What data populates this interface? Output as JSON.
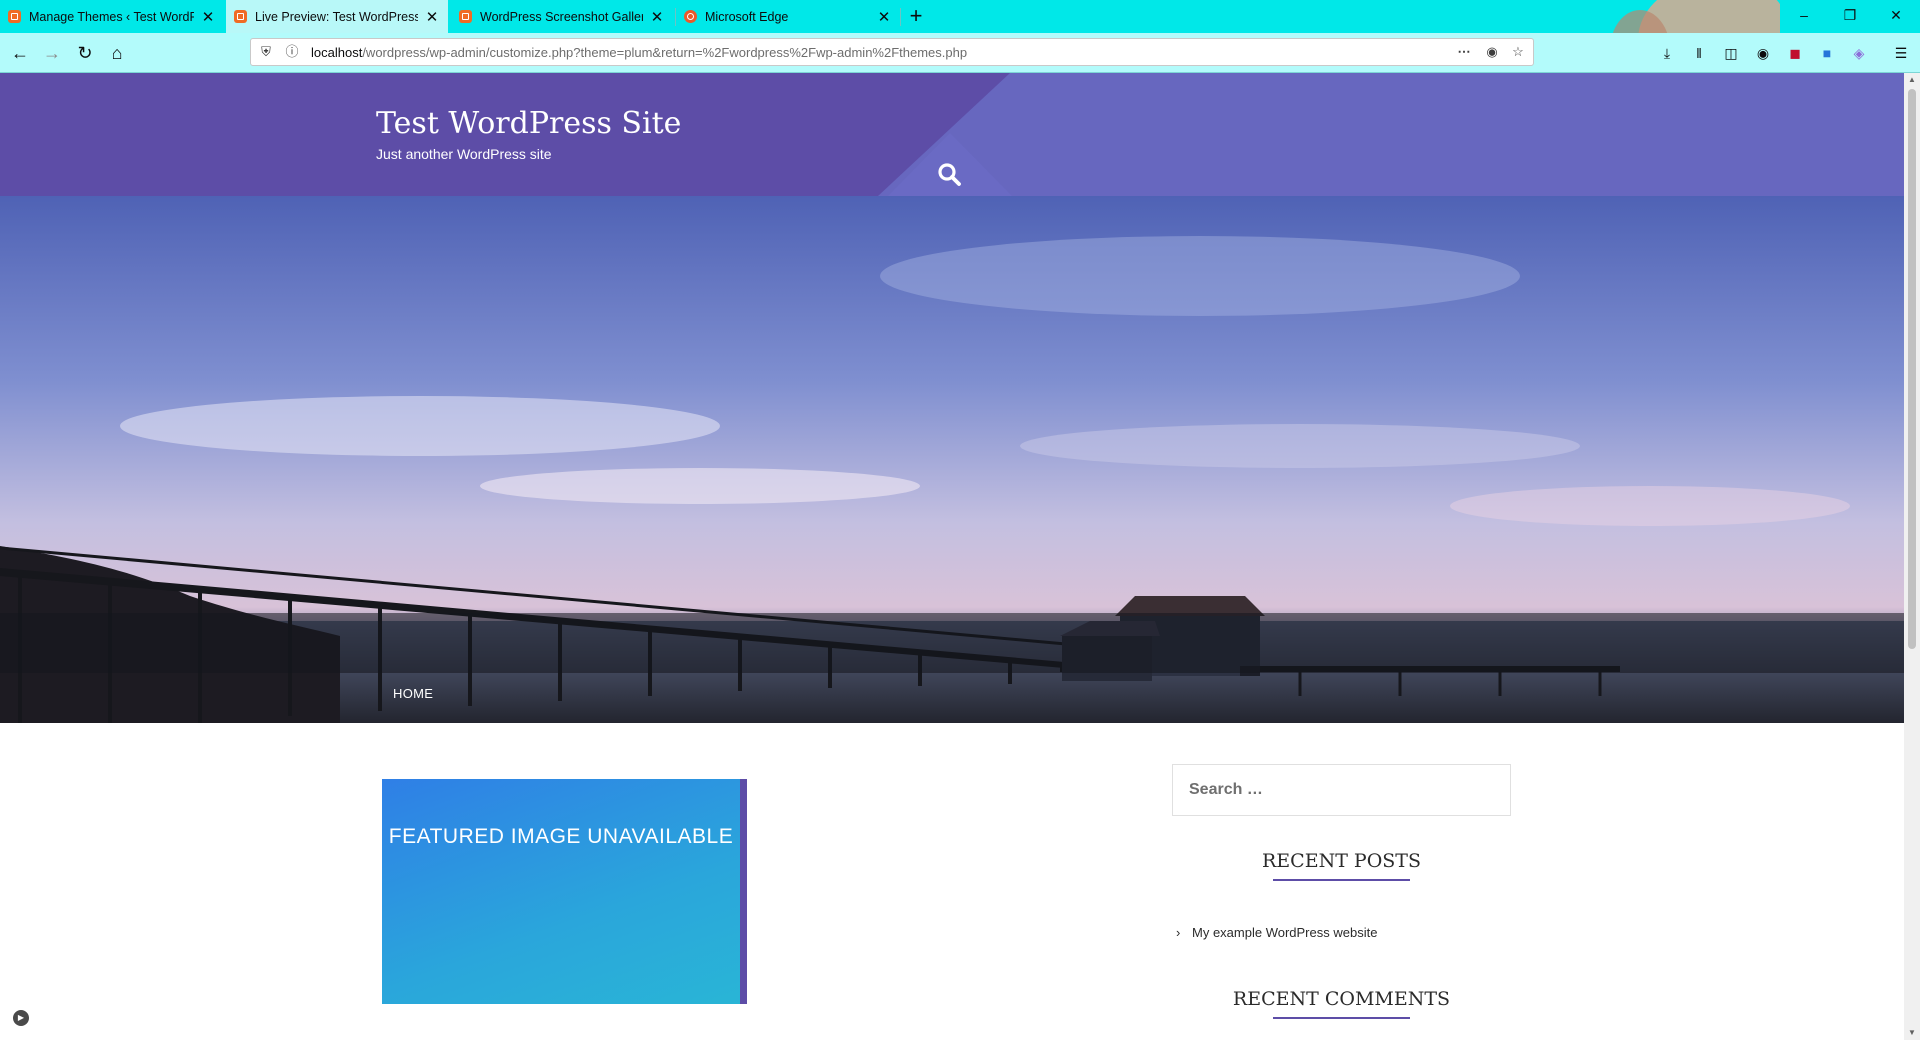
{
  "browser": {
    "tabs": [
      {
        "title": "Manage Themes ‹ Test WordPr",
        "active": false,
        "icon": "wordpress-favicon-icon"
      },
      {
        "title": "Live Preview: Test WordPress Si",
        "active": true,
        "icon": "wordpress-favicon-icon"
      },
      {
        "title": "WordPress Screenshot Gallery",
        "active": false,
        "icon": "wordpress-favicon-icon"
      },
      {
        "title": "Microsoft Edge",
        "active": false,
        "icon": "edge-favicon-icon"
      }
    ],
    "url_host": "localhost",
    "url_path": "/wordpress/wp-admin/customize.php?theme=plum&return=%2Fwordpress%2Fwp-admin%2Fthemes.php",
    "tab_strip_color": "#00e8e8",
    "toolbar_color": "#b3fbfb"
  },
  "site": {
    "title": "Test WordPress Site",
    "tagline": "Just another WordPress site",
    "menu_home": "HOME",
    "header_color": "#5d4da7",
    "accent_color": "#6767bf"
  },
  "featured_image": {
    "label": "FEATURED IMAGE UNAVAILABLE"
  },
  "sidebar": {
    "search_placeholder": "Search …",
    "recent_posts_title": "RECENT POSTS",
    "recent_posts": [
      "My example WordPress website"
    ],
    "recent_comments_title": "RECENT COMMENTS"
  }
}
